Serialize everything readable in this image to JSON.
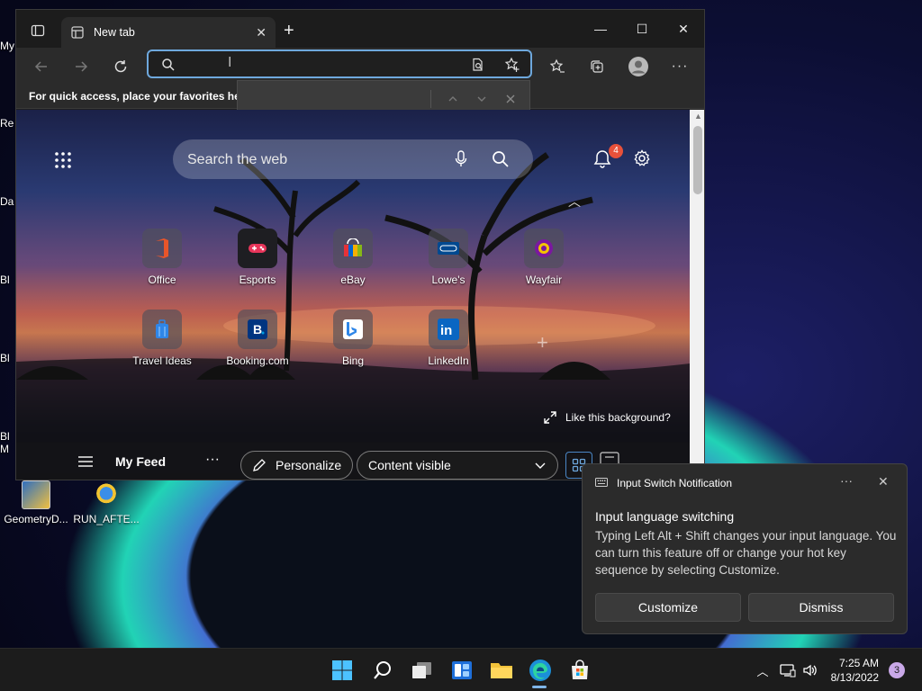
{
  "desktop": {
    "peek_labels": [
      "My",
      "Re",
      "Da",
      "Bl",
      "Bl",
      "Bl",
      "M"
    ],
    "icons": [
      {
        "label": "GeometryD...",
        "icon": "geometry-app-icon"
      },
      {
        "label": "RUN_AFTE...",
        "icon": "installer-icon"
      }
    ]
  },
  "browser": {
    "tab": {
      "title": "New tab",
      "icon": "new-tab-page-icon"
    },
    "new_tab_symbol": "+",
    "window_controls": {
      "minimize": "—",
      "maximize": "☐",
      "close": "✕"
    },
    "favorites_bar_text": "For quick access, place your favorites here",
    "address_value": "",
    "findbar": {
      "up": "^",
      "down": "v",
      "close": "✕"
    }
  },
  "newtab_page": {
    "search_placeholder": "Search the web",
    "notification_count": "4",
    "tiles_row1": [
      {
        "label": "Office",
        "icon": "office-icon"
      },
      {
        "label": "Esports",
        "icon": "esports-icon"
      },
      {
        "label": "eBay",
        "icon": "ebay-icon"
      },
      {
        "label": "Lowe's",
        "icon": "lowes-icon"
      },
      {
        "label": "Wayfair",
        "icon": "wayfair-icon"
      }
    ],
    "tiles_row2": [
      {
        "label": "Travel Ideas",
        "icon": "travel-icon"
      },
      {
        "label": "Booking.com",
        "icon": "booking-icon"
      },
      {
        "label": "Bing",
        "icon": "bing-icon"
      },
      {
        "label": "LinkedIn",
        "icon": "linkedin-icon"
      }
    ],
    "add_tile_symbol": "+",
    "like_background": "Like this background?",
    "feed": {
      "title": "My Feed",
      "more": "···",
      "personalize": "Personalize",
      "content_visibility": "Content visible"
    }
  },
  "notification": {
    "app_title": "Input Switch Notification",
    "more": "···",
    "close": "✕",
    "heading": "Input language switching",
    "body": "Typing Left Alt + Shift changes your input language. You can turn this feature off or change your hot key sequence by selecting Customize.",
    "customize_label": "Customize",
    "dismiss_label": "Dismiss"
  },
  "taskbar": {
    "apps": [
      "start-icon",
      "search-icon",
      "task-view-icon",
      "widgets-icon",
      "file-explorer-icon",
      "edge-icon",
      "store-icon"
    ],
    "time": "7:25 AM",
    "date": "8/13/2022",
    "notification_count": "3"
  },
  "colors": {
    "accent": "#6ea8dd",
    "badge_red": "#e8513a",
    "taskbar_bg": "#1c1c1c"
  }
}
